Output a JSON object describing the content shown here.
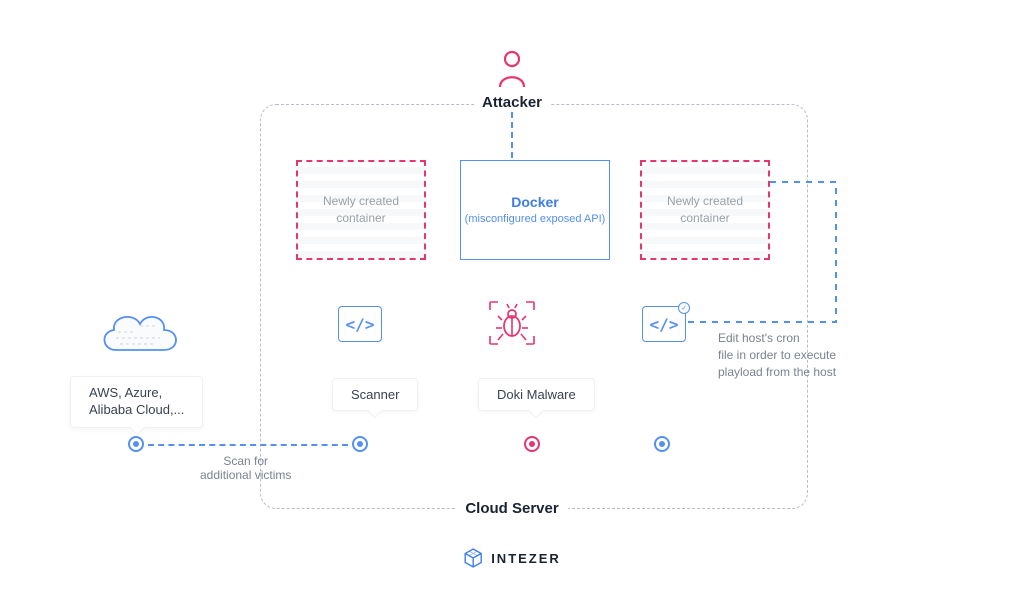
{
  "attacker": {
    "label": "Attacker"
  },
  "cloud_server": {
    "label": "Cloud Server"
  },
  "containers": {
    "left": {
      "label": "Newly created container"
    },
    "right": {
      "label": "Newly created container"
    }
  },
  "docker": {
    "title": "Docker",
    "subtitle": "(misconfigured exposed API)"
  },
  "code_glyph": "</>",
  "labels": {
    "scanner": "Scanner",
    "doki": "Doki Malware",
    "aws_line1": "AWS, Azure,",
    "aws_line2": "Alibaba Cloud,..."
  },
  "scan_text": {
    "l1": "Scan for",
    "l2": "additional victims"
  },
  "cron_text": {
    "l1": "Edit host's cron",
    "l2": "file in order to execute",
    "l3": "playload from the host"
  },
  "brand": {
    "name": "INTEZER"
  },
  "colors": {
    "blue": "#5490f0",
    "pink": "#e6366f",
    "grey": "#7a8290"
  }
}
